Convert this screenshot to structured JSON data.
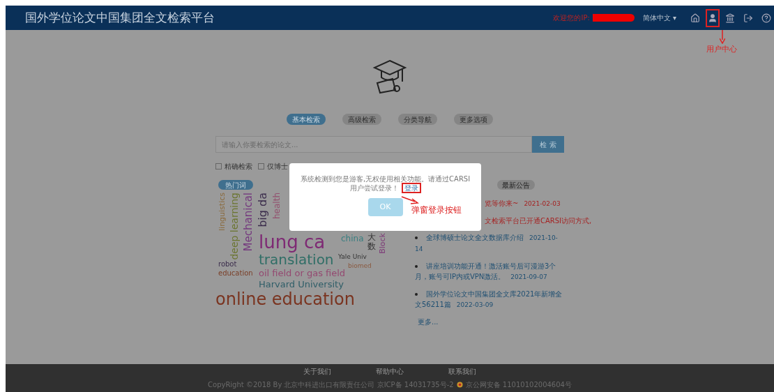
{
  "header": {
    "title": "国外学位论文中国集团全文检索平台",
    "ip_label": "欢迎您的IP:",
    "language": "简体中文 ▾",
    "annotation": "用户中心"
  },
  "search_tabs": [
    {
      "label": "基本检索",
      "selected": true
    },
    {
      "label": "高级检索",
      "selected": false
    },
    {
      "label": "分类导航",
      "selected": false
    },
    {
      "label": "更多选项",
      "selected": false
    }
  ],
  "search": {
    "placeholder": "请输入你要检索的论文...",
    "button": "检 索"
  },
  "options": [
    {
      "label": "精确检索",
      "checked": false
    },
    {
      "label": "仅博士",
      "checked": false
    }
  ],
  "hot_words": {
    "tab": "热门词",
    "words": [
      {
        "text": "linguistics",
        "color": "#8a6a3c"
      },
      {
        "text": "deep learning",
        "color": "#6b7530"
      },
      {
        "text": "Mechanical",
        "color": "#74397e"
      },
      {
        "text": "big da",
        "color": "#3b2d4c"
      },
      {
        "text": "lung ca",
        "color": "#7e2a74"
      },
      {
        "text": "health",
        "color": "#93506e"
      },
      {
        "text": "china",
        "color": "#3a7f80"
      },
      {
        "text": "大数",
        "color": "#333333"
      },
      {
        "text": "Block",
        "color": "#7e3a78"
      },
      {
        "text": "Yale Univ",
        "color": "#333333"
      },
      {
        "text": "biomed",
        "color": "#8a5a40"
      },
      {
        "text": "robot",
        "color": "#3b2d4c"
      },
      {
        "text": "education",
        "color": "#7a3e26"
      },
      {
        "text": "translation",
        "color": "#2f6e66"
      },
      {
        "text": "oil field or gas field",
        "color": "#944870"
      },
      {
        "text": "Harvard University",
        "color": "#2f5e68"
      },
      {
        "text": "online education",
        "color": "#7a3420"
      }
    ]
  },
  "news": {
    "tab": "最新公告",
    "items": [
      {
        "text": "览等你来~",
        "date": "2021-02-03",
        "hot": true
      },
      {
        "text": "文检索平台已开通CARSI访问方式,",
        "hot": true
      },
      {
        "text": "全球博硕士论文全文数据库介绍",
        "date": "2021-10-14",
        "hot": false
      },
      {
        "text": "讲座培训功能开通！激活账号后可漫游3个月，账号可IP内或VPN激活。",
        "date": "2021-09-07",
        "hot": false
      },
      {
        "text": "国外学位论文中国集团全文库2021年新增全文56211篇",
        "date": "2022-03-09",
        "hot": false
      }
    ],
    "more": "更多..."
  },
  "dialog": {
    "message": "系统检测到您是游客,无权使用相关功能。请通过CARSI用户尝试登录！",
    "link": "登录",
    "annotation": "弹窗登录按钮",
    "ok": "OK"
  },
  "footer": {
    "links": [
      "关于我们",
      "帮助中心",
      "联系我们"
    ],
    "copyright": "CopyRight ©2018 By 北京中科进出口有限责任公司 京ICP备 14031735号-2",
    "police": "京公网安备 11010102004604号"
  }
}
